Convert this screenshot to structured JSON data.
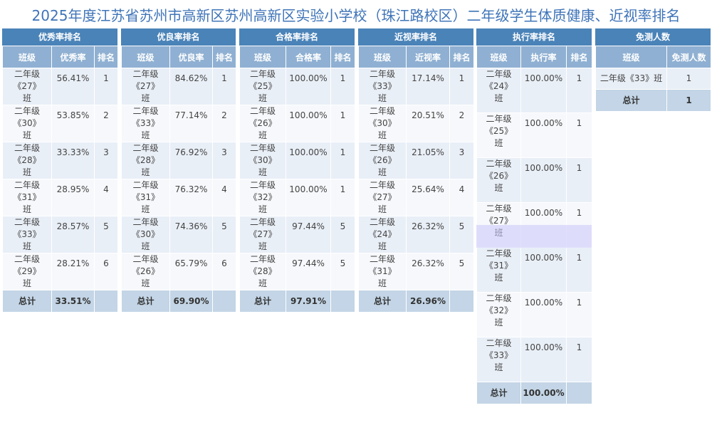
{
  "title": "2025年度江苏省苏州市高新区苏州高新区实验小学校（珠江路校区）二年级学生体质健康、近视率排名",
  "panels": [
    {
      "title": "优秀率排名",
      "headers": [
        "班级",
        "优秀率",
        "排名"
      ],
      "rows": [
        [
          "二年级《27》班",
          "56.41%",
          "1"
        ],
        [
          "二年级《30》班",
          "53.85%",
          "2"
        ],
        [
          "二年级《28》班",
          "33.33%",
          "3"
        ],
        [
          "二年级《31》班",
          "28.95%",
          "4"
        ],
        [
          "二年级《33》班",
          "28.57%",
          "5"
        ],
        [
          "二年级《29》班",
          "28.21%",
          "6"
        ]
      ],
      "total": [
        "总计",
        "33.51%",
        ""
      ]
    },
    {
      "title": "优良率排名",
      "headers": [
        "班级",
        "优良率",
        "排名"
      ],
      "rows": [
        [
          "二年级《27》班",
          "84.62%",
          "1"
        ],
        [
          "二年级《33》班",
          "77.14%",
          "2"
        ],
        [
          "二年级《28》班",
          "76.92%",
          "3"
        ],
        [
          "二年级《31》班",
          "76.32%",
          "4"
        ],
        [
          "二年级《30》班",
          "74.36%",
          "5"
        ],
        [
          "二年级《26》班",
          "65.79%",
          "6"
        ]
      ],
      "total": [
        "总计",
        "69.90%",
        ""
      ]
    },
    {
      "title": "合格率排名",
      "headers": [
        "班级",
        "合格率",
        "排名"
      ],
      "rows": [
        [
          "二年级《25》班",
          "100.00%",
          "1"
        ],
        [
          "二年级《26》班",
          "100.00%",
          "1"
        ],
        [
          "二年级《30》班",
          "100.00%",
          "1"
        ],
        [
          "二年级《32》班",
          "100.00%",
          "1"
        ],
        [
          "二年级《27》班",
          "97.44%",
          "5"
        ],
        [
          "二年级《28》班",
          "97.44%",
          "5"
        ]
      ],
      "total": [
        "总计",
        "97.91%",
        ""
      ]
    },
    {
      "title": "近视率排名",
      "headers": [
        "班级",
        "近视率",
        "排名"
      ],
      "rows": [
        [
          "二年级《33》班",
          "17.14%",
          "1"
        ],
        [
          "二年级《30》班",
          "20.51%",
          "2"
        ],
        [
          "二年级《26》班",
          "21.05%",
          "3"
        ],
        [
          "二年级《27》班",
          "25.64%",
          "4"
        ],
        [
          "二年级《24》班",
          "26.32%",
          "5"
        ],
        [
          "二年级《31》班",
          "26.32%",
          "5"
        ]
      ],
      "total": [
        "总计",
        "26.96%",
        ""
      ]
    },
    {
      "title": "执行率排名",
      "headers": [
        "班级",
        "执行率",
        "排名"
      ],
      "rows": [
        [
          "二年级《24》班",
          "100.00%",
          "1"
        ],
        [
          "二年级《25》班",
          "100.00%",
          "1"
        ],
        [
          "二年级《26》班",
          "100.00%",
          "1"
        ],
        [
          "二年级《27》班",
          "100.00%",
          "1"
        ],
        [
          "二年级《31》班",
          "100.00%",
          "1"
        ],
        [
          "二年级《32》班",
          "100.00%",
          "1"
        ],
        [
          "二年级《33》班",
          "100.00%",
          "1"
        ]
      ],
      "total": [
        "总计",
        "100.00%",
        ""
      ]
    },
    {
      "title": "免测人数",
      "headers": [
        "班级",
        "免测人数"
      ],
      "rows": [
        [
          "二年级《33》班",
          "1"
        ]
      ],
      "total": [
        "总计",
        "1"
      ]
    }
  ]
}
